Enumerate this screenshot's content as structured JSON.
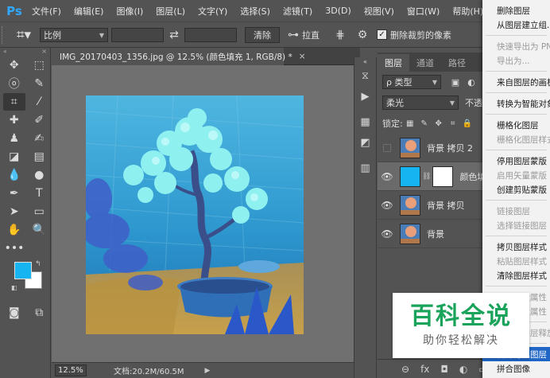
{
  "app": {
    "logo": "Ps"
  },
  "menubar": {
    "items": [
      "文件(F)",
      "编辑(E)",
      "图像(I)",
      "图层(L)",
      "文字(Y)",
      "选择(S)",
      "滤镜(T)",
      "3D(D)",
      "视图(V)",
      "窗口(W)",
      "帮助(H)"
    ]
  },
  "options": {
    "ratio_select": "比例",
    "swap_icon": "⇄",
    "clear_button": "清除",
    "straighten_label": "拉直",
    "delete_cropped_label": "删除裁剪的像素",
    "delete_cropped_checked": true
  },
  "document": {
    "tab_title": "IMG_20170403_1356.jpg @ 12.5% (颜色填充 1, RGB/8) *",
    "close": "×",
    "zoom": "12.5%",
    "doc_size": "文档:20.2M/60.5M"
  },
  "colors": {
    "foreground": "#16b4f0",
    "background": "#ffffff",
    "menu_highlight": "#1f66c7",
    "watermark_green": "#1aa35a"
  },
  "layers_panel": {
    "tabs": [
      "图层",
      "通道",
      "路径"
    ],
    "active_tab": 0,
    "filter_label": "ρ 类型",
    "blend_mode": "柔光",
    "opacity_label": "不透",
    "lock_label": "锁定:",
    "layers": [
      {
        "name": "背景 拷贝 2",
        "visible": false,
        "selected": false,
        "thumb": "photo"
      },
      {
        "name": "颜色填",
        "visible": true,
        "selected": true,
        "thumb": "fill"
      },
      {
        "name": "背景 拷贝",
        "visible": true,
        "selected": false,
        "thumb": "photo"
      },
      {
        "name": "背景",
        "visible": true,
        "selected": false,
        "thumb": "photo"
      }
    ],
    "footer": [
      "⊖",
      "fx",
      "◘",
      "◐",
      "▭"
    ]
  },
  "context_menu": {
    "items": [
      {
        "label": "删除图层",
        "disabled": false
      },
      {
        "label": "从图层建立组...",
        "disabled": false
      },
      {
        "sep": true
      },
      {
        "label": "快速导出为 PN",
        "disabled": true
      },
      {
        "label": "导出为...",
        "disabled": true
      },
      {
        "sep": true
      },
      {
        "label": "来自图层的画板",
        "disabled": false
      },
      {
        "sep": true
      },
      {
        "label": "转换为智能对象",
        "disabled": false
      },
      {
        "sep": true
      },
      {
        "label": "栅格化图层",
        "disabled": false
      },
      {
        "label": "栅格化图层样式",
        "disabled": true
      },
      {
        "sep": true
      },
      {
        "label": "停用图层蒙版",
        "disabled": false
      },
      {
        "label": "启用矢量蒙版",
        "disabled": true
      },
      {
        "label": "创建剪贴蒙版",
        "disabled": false
      },
      {
        "sep": true
      },
      {
        "label": "链接图层",
        "disabled": true
      },
      {
        "label": "选择链接图层",
        "disabled": true
      },
      {
        "sep": true
      },
      {
        "label": "拷贝图层样式",
        "disabled": false
      },
      {
        "label": "粘贴图层样式",
        "disabled": true
      },
      {
        "label": "清除图层样式",
        "disabled": false
      },
      {
        "sep": true
      },
      {
        "label": "复制形状属性",
        "disabled": true
      },
      {
        "label": "粘贴形状属性",
        "disabled": true
      },
      {
        "sep": true
      },
      {
        "label": "从隔离图层释放",
        "disabled": true
      },
      {
        "sep": true
      },
      {
        "label": "合并可见图层",
        "disabled": false,
        "highlight": true
      },
      {
        "label": "拼合图像",
        "disabled": false
      }
    ]
  },
  "watermark": {
    "main": "百科全说",
    "sub": "助你轻松解决"
  }
}
